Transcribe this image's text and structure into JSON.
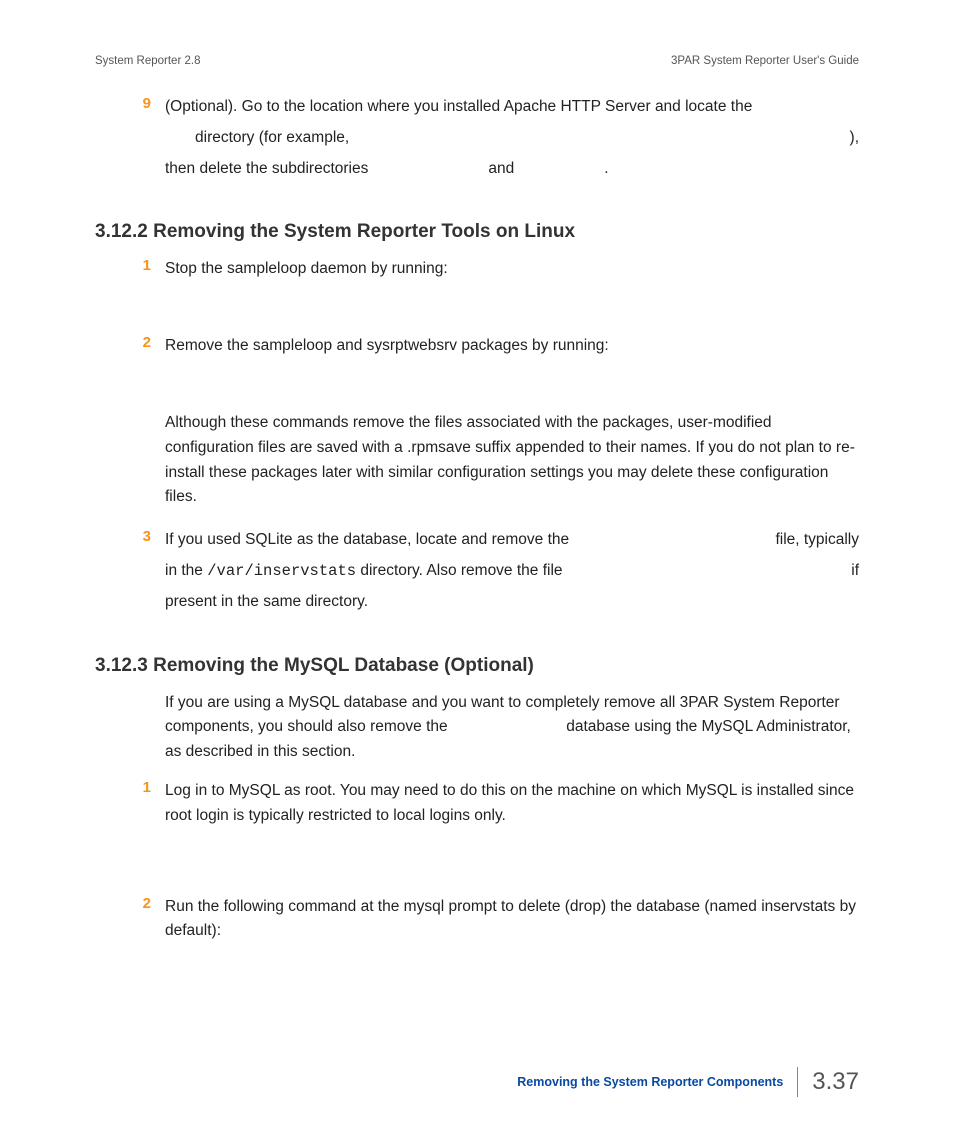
{
  "header": {
    "left": "System Reporter 2.8",
    "right": "3PAR System Reporter User's Guide"
  },
  "s0": {
    "num9": "9",
    "t9a": "(Optional). Go to the location where you installed Apache HTTP Server and locate the",
    "t9b": "directory (for example,",
    "t9c": "),",
    "t9d": "then delete the subdirectories",
    "t9e": "and",
    "t9f": "."
  },
  "s1": {
    "title": "3.12.2 Removing the System Reporter Tools on Linux",
    "n1": "1",
    "t1": "Stop the sampleloop daemon by running:",
    "n2": "2",
    "t2": "Remove the sampleloop and sysrptwebsrv packages by running:",
    "note": "Although these commands remove the files associated with the packages, user-modified configuration files are saved with a .rpmsave suffix appended to their names. If you do not plan to re-install these packages later with similar configuration settings you may delete these configuration files.",
    "n3": "3",
    "t3a": "If you used SQLite as the database, locate and remove the",
    "t3b": "file, typically",
    "t3c": "in the ",
    "t3d": "/var/inservstats",
    "t3e": " directory. Also remove the file",
    "t3f": "if",
    "t3g": "present in the same directory."
  },
  "s2": {
    "title": "3.12.3 Removing the MySQL Database (Optional)",
    "intro1": "If you are using a MySQL database and you want to completely remove all 3PAR System Reporter components, you should also remove the",
    "intro2": "database using the MySQL Administrator, as described in this section.",
    "n1": "1",
    "t1": "Log in to MySQL as root. You may need to do this on the machine on which MySQL is installed since root login is typically restricted to local logins only.",
    "n2": "2",
    "t2": "Run the following command at the mysql prompt to delete (drop) the database (named inservstats by default):"
  },
  "footer": {
    "title": "Removing the System Reporter Components",
    "page": "3.37"
  }
}
